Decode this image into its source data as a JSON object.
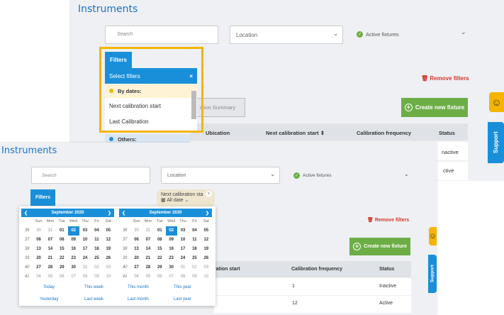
{
  "back": {
    "title": "Instruments",
    "search_placeholder": "Search",
    "location_label": "Location",
    "active_fixtures_label": "Active fixtures",
    "filters_tab": "Filters",
    "remove_filters_label": "Remove filters",
    "create_button_label": "Create new fixture",
    "action_summary_label": "ction Summary",
    "table_headers": [
      "Ubication",
      "Next calibration start",
      "Calibration frequency",
      "Status"
    ],
    "statuses": [
      "nactive",
      "ctive"
    ],
    "filter_dropdown": {
      "header": "Select filters",
      "close_icon": "×",
      "group_by_dates": "By dates:",
      "items": [
        "Next calibration start",
        "Last Calibration"
      ],
      "group_others": "Others:"
    },
    "support_label": "Support"
  },
  "front": {
    "title": "Instruments",
    "search_placeholder": "Search",
    "location_label": "Location",
    "active_fixtures_label": "Active fixtures",
    "filters_tab": "Filters",
    "filter_chip": {
      "label": "Next calibration sta",
      "value": "All date",
      "close": "×"
    },
    "remove_filters_label": "Remove filters",
    "create_button_label": "Create new fixture",
    "table_headers": [
      "ration start",
      "Calibration frequency",
      "Status"
    ],
    "rows": [
      {
        "frequency": "1",
        "status": "Inactive"
      },
      {
        "frequency": "12",
        "status": "Active"
      }
    ],
    "support_label": "Support",
    "calendar_month": "September 2020",
    "calendar_left": {
      "month": "September 2020",
      "weekday_labels": [
        "Sun",
        "Mon",
        "Tue",
        "Wed",
        "Thu",
        "Fri",
        "Sat"
      ],
      "weeks": [
        {
          "num": "36",
          "days": [
            "30",
            "31",
            "01",
            "02",
            "03",
            "04",
            "05"
          ]
        },
        {
          "num": "37",
          "days": [
            "06",
            "07",
            "08",
            "09",
            "10",
            "11",
            "12"
          ]
        },
        {
          "num": "38",
          "days": [
            "13",
            "14",
            "15",
            "16",
            "17",
            "18",
            "19"
          ]
        },
        {
          "num": "39",
          "days": [
            "20",
            "21",
            "22",
            "23",
            "24",
            "25",
            "26"
          ]
        },
        {
          "num": "40",
          "days": [
            "27",
            "28",
            "29",
            "30",
            "01",
            "02",
            "03"
          ]
        },
        {
          "num": "41",
          "days": [
            "04",
            "05",
            "06",
            "07",
            "08",
            "09",
            "10"
          ]
        }
      ],
      "selected_day": "02"
    },
    "calendar_right": {
      "month": "September 2020",
      "weekday_labels": [
        "Sun",
        "Mon",
        "Tue",
        "Wed",
        "Thu",
        "Fri",
        "Sat"
      ],
      "weeks": [
        {
          "num": "36",
          "days": [
            "30",
            "31",
            "01",
            "02",
            "03",
            "04",
            "05"
          ]
        },
        {
          "num": "37",
          "days": [
            "06",
            "07",
            "08",
            "09",
            "10",
            "11",
            "12"
          ]
        },
        {
          "num": "38",
          "days": [
            "13",
            "14",
            "15",
            "16",
            "17",
            "18",
            "19"
          ]
        },
        {
          "num": "39",
          "days": [
            "20",
            "21",
            "22",
            "23",
            "24",
            "25",
            "26"
          ]
        },
        {
          "num": "40",
          "days": [
            "27",
            "28",
            "29",
            "30",
            "01",
            "02",
            "03"
          ]
        },
        {
          "num": "41",
          "days": [
            "04",
            "05",
            "06",
            "07",
            "08",
            "09",
            "10"
          ]
        }
      ],
      "selected_day": "02"
    },
    "quick_ranges": [
      "Today",
      "This week",
      "This month",
      "This year",
      "Yesterday",
      "Last week",
      "Last month",
      "Last year"
    ]
  },
  "colors": {
    "accent_blue": "#1a8fd9",
    "green": "#6cae45",
    "red": "#d9362c",
    "highlight": "#f5b400"
  }
}
